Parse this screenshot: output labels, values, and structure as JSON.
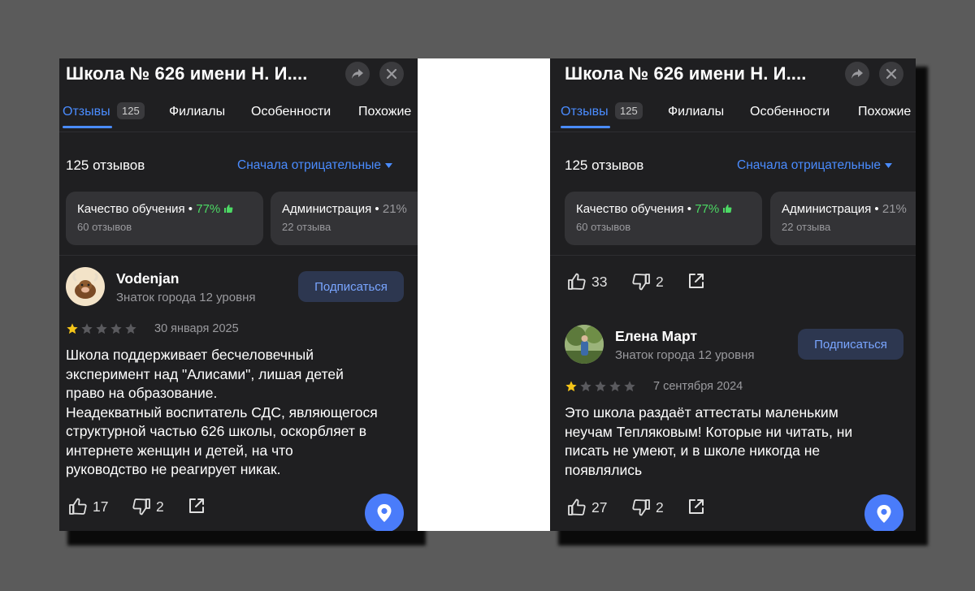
{
  "left": {
    "title": "Школа № 626 имени Н. И....",
    "tabs": [
      {
        "label": "Отзывы",
        "badge": "125"
      },
      {
        "label": "Филиалы"
      },
      {
        "label": "Особенности"
      },
      {
        "label": "Похожие"
      }
    ],
    "review_count": "125 отзывов",
    "sort_label": "Сначала отрицательные",
    "chips": [
      {
        "title": "Качество обучения",
        "pct": "77%",
        "sub": "60 отзывов"
      },
      {
        "title": "Администрация",
        "pct": "21%",
        "sub": "22 отзыва"
      }
    ],
    "review": {
      "author": "Vodenjan",
      "level": "Знаток города 12 уровня",
      "subscribe": "Подписаться",
      "rating": 1,
      "date": "30 января 2025",
      "text": "Школа поддерживает бесчеловечный\nэксперимент над \"Алисами\", лишая детей\nправо на образование.\nНеадекватный воспитатель СДС, являющегося\nструктурной частью 626 школы, оскорбляет в\nинтернете женщин и детей, на что\nруководство не реагирует никак.",
      "likes": "17",
      "dislikes": "2"
    }
  },
  "right": {
    "title": "Школа № 626 имени Н. И....",
    "tabs": [
      {
        "label": "Отзывы",
        "badge": "125"
      },
      {
        "label": "Филиалы"
      },
      {
        "label": "Особенности"
      },
      {
        "label": "Похожие"
      }
    ],
    "review_count": "125 отзывов",
    "sort_label": "Сначала отрицательные",
    "chips": [
      {
        "title": "Качество обучения",
        "pct": "77%",
        "sub": "60 отзывов"
      },
      {
        "title": "Администрация",
        "pct": "21%",
        "sub": "22 отзыва"
      }
    ],
    "prev_actions": {
      "likes": "33",
      "dislikes": "2"
    },
    "review": {
      "author": "Елена Март",
      "level": "Знаток города 12 уровня",
      "subscribe": "Подписаться",
      "rating": 1,
      "date": "7 сентября 2024",
      "text": "Это школа раздаёт аттестаты маленьким\nнеучам Тепляковым! Которые ни читать, ни\nписать не умеют, и в школе никогда не\nпоявлялись",
      "likes": "27",
      "dislikes": "2"
    }
  },
  "colors": {
    "panel_bg": "#1f1f21",
    "accent": "#4a8cff",
    "positive": "#4cd964",
    "star_on": "#f5c518",
    "star_off": "#5a5a5e"
  },
  "icons": [
    "share-icon",
    "close-icon",
    "thumb-up-icon",
    "thumb-down-icon",
    "external-share-icon",
    "map-pin-icon",
    "caret-down-icon",
    "star-icon",
    "yak-avatar",
    "photo-avatar"
  ]
}
